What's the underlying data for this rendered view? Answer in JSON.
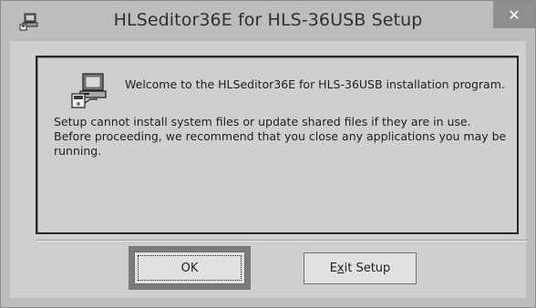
{
  "window": {
    "title": "HLSeditor36E for HLS-36USB Setup",
    "close_glyph": "✕"
  },
  "content": {
    "welcome": "Welcome to the HLSeditor36E for HLS-36USB installation program.",
    "message": "Setup cannot install system files or update shared files if they are in use. Before proceeding, we recommend that you close any applications you may be running."
  },
  "buttons": {
    "ok_label": "OK",
    "exit_label_pre": "E",
    "exit_label_mnemonic": "x",
    "exit_label_post": "it Setup"
  },
  "icons": {
    "app": "installer-computer-icon",
    "setup": "setup-computer-icon"
  }
}
